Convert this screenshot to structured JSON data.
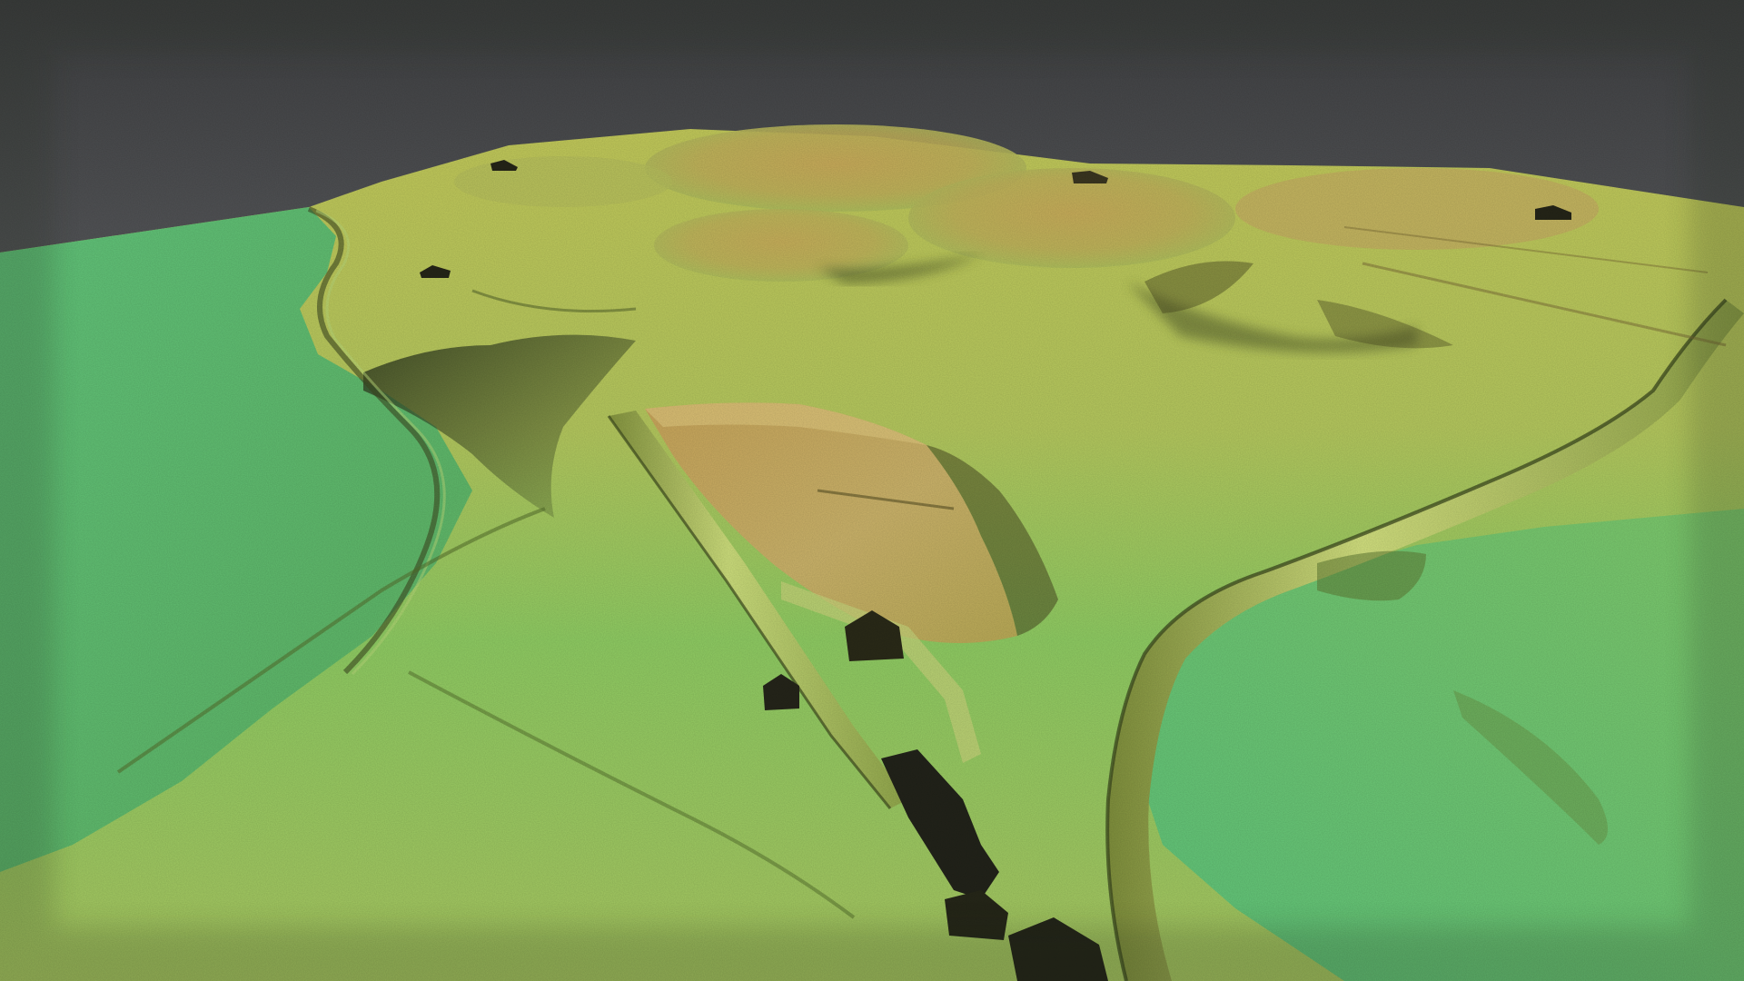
{
  "viewer": {
    "background_color": "#5f6164",
    "sky_top": "#3f4042",
    "sky_bottom": "#8c8f93"
  },
  "terrain": {
    "colormap": {
      "low": "#5fc57b",
      "mid_low": "#8fcc63",
      "mid": "#c2c95a",
      "mid_high": "#c9a85a",
      "high": "#b88c4a"
    },
    "shadow_color": "#2f3a20"
  },
  "features": [
    {
      "name": "lowland-plain-left"
    },
    {
      "name": "lowland-plain-right"
    },
    {
      "name": "central-ridge"
    },
    {
      "name": "raised-plateau"
    },
    {
      "name": "winding-road"
    },
    {
      "name": "straight-track"
    },
    {
      "name": "bank-ditch-left"
    },
    {
      "name": "field-boundary"
    },
    {
      "name": "building-cluster"
    },
    {
      "name": "distant-hills"
    }
  ]
}
